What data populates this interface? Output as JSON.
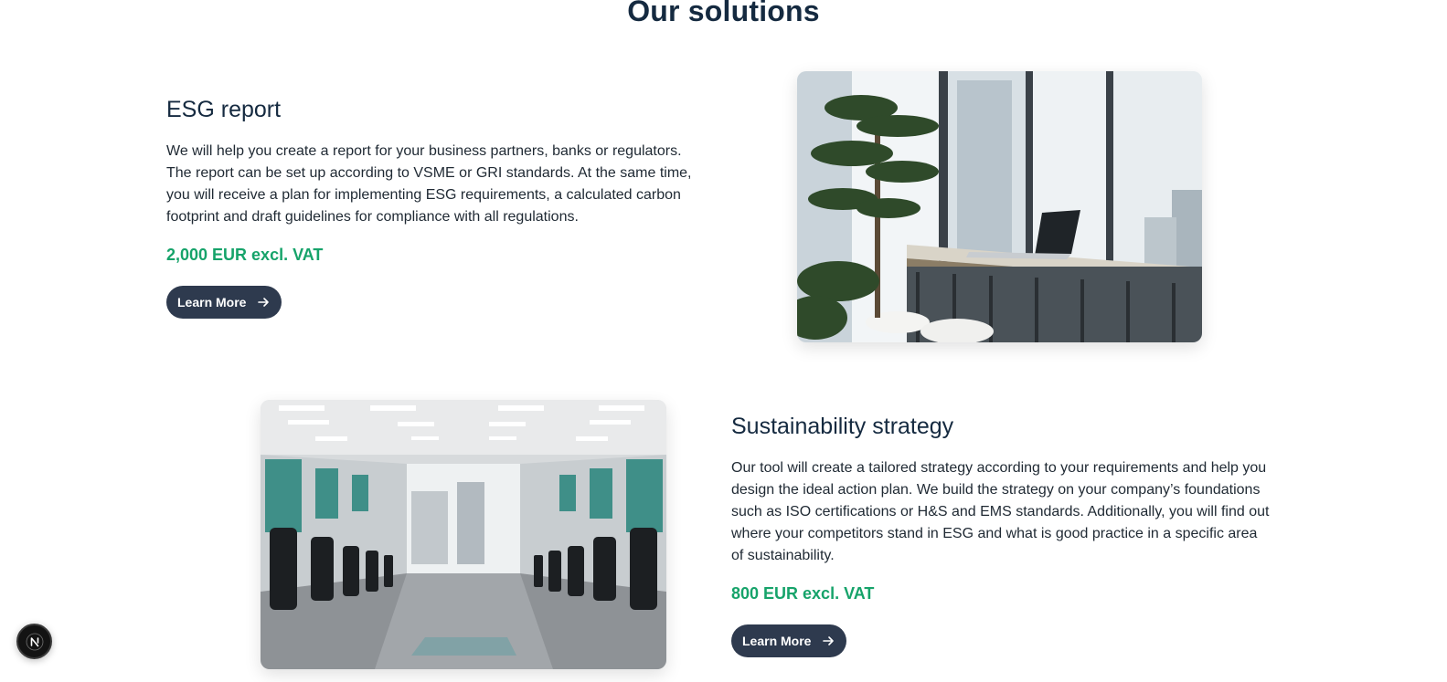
{
  "section": {
    "title": "Our solutions"
  },
  "solutions": [
    {
      "title": "ESG report",
      "description": "We will help you create a report for your business partners, banks or regulators. The report can be set up according to VSME or GRI standards. At the same time, you will receive a plan for implementing ESG requirements, a calculated carbon footprint and draft guidelines for compliance with all regulations.",
      "price": "2,000 EUR excl. VAT",
      "button_label": "Learn More",
      "image_alt": "Office with plants and laptop by window"
    },
    {
      "title": "Sustainability strategy",
      "description": "Our tool will create a tailored strategy according to your requirements and help you design the ideal action plan. We build the strategy on your company’s foundations such as ISO certifications or H&S and EMS standards. Additionally, you will find out where your competitors stand in ESG and what is good practice in a specific area of sustainability.",
      "price": "800 EUR excl. VAT",
      "button_label": "Learn More",
      "image_alt": "Open office with cubicles and chairs"
    }
  ],
  "colors": {
    "accent": "#16a36a",
    "button_bg": "#2e3a4e",
    "heading": "#152a40"
  },
  "icons": {
    "button": "arrow-right-icon",
    "fab": "next-logo-icon"
  }
}
